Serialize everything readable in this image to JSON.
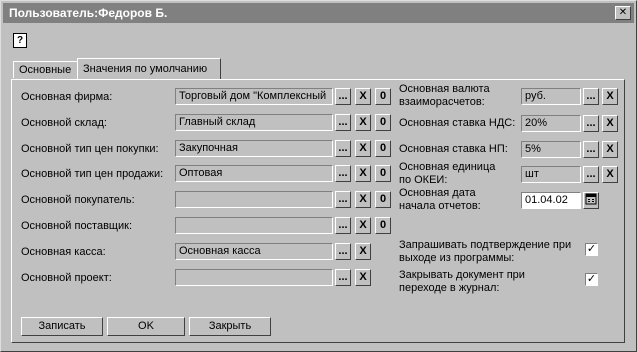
{
  "window": {
    "title": "Пользователь:Федоров Б.",
    "close": "✕",
    "help": "?"
  },
  "tabs": [
    {
      "label": "Основные"
    },
    {
      "label": "Значения по умолчанию"
    }
  ],
  "left": [
    {
      "label": "Основная фирма:",
      "value": "Торговый дом \"Комплексный"
    },
    {
      "label": "Основной склад:",
      "value": "Главный склад"
    },
    {
      "label": "Основной тип цен покупки:",
      "value": "Закупочная"
    },
    {
      "label": "Основной тип цен продажи:",
      "value": "Оптовая"
    },
    {
      "label": "Основной покупатель:",
      "value": ""
    },
    {
      "label": "Основной поставщик:",
      "value": ""
    },
    {
      "label": "Основная касса:",
      "value": "Основная касса"
    },
    {
      "label": "Основной проект:",
      "value": ""
    }
  ],
  "right": [
    {
      "label": "Основная валюта\nвзаиморасчетов:",
      "value": "руб."
    },
    {
      "label": "Основная ставка НДС:",
      "value": "20%"
    },
    {
      "label": "Основная ставка НП:",
      "value": "5%"
    },
    {
      "label": "Основная единица\nпо ОКЕИ:",
      "value": "шт"
    },
    {
      "label": "Основная дата\nначала отчетов:",
      "value": "01.04.02"
    }
  ],
  "options": [
    {
      "label": "Запрашивать подтверждение при\nвыходе из программы:",
      "checked": true
    },
    {
      "label": "Закрывать документ при\nпереходе в журнал:",
      "checked": true
    }
  ],
  "icons": {
    "select": "...",
    "clear": "X",
    "zero": "0",
    "check": "✓"
  },
  "buttons": {
    "save": "Записать",
    "ok": "OK",
    "close": "Закрыть"
  }
}
